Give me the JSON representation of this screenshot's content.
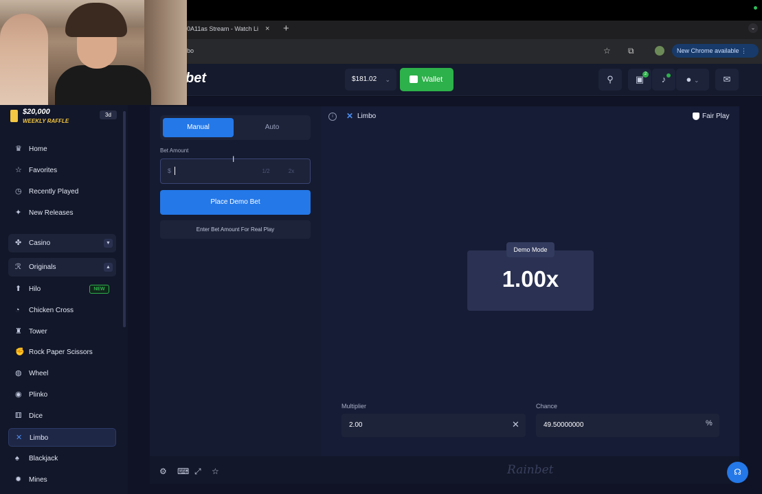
{
  "browser": {
    "tab_title": "0A11as Stream - Watch Li",
    "tab_close": "×",
    "new_tab": "+",
    "tab_menu": "⌄",
    "address_fragment": "bo",
    "new_chrome_label": "New Chrome available ⋮"
  },
  "header": {
    "logo_fragment": "bet",
    "balance": "$181.02",
    "wallet_label": "Wallet",
    "notification_count": "2"
  },
  "sidebar": {
    "raffle_amount": "$20,000",
    "raffle_label": "WEEKLY RAFFLE",
    "raffle_days": "3d",
    "items": [
      {
        "label": "Home",
        "icon": "crown-icon"
      },
      {
        "label": "Favorites",
        "icon": "star-icon"
      },
      {
        "label": "Recently Played",
        "icon": "clock-icon"
      },
      {
        "label": "New Releases",
        "icon": "sparkle-icon"
      }
    ],
    "casino_label": "Casino",
    "originals_label": "Originals",
    "games": [
      {
        "label": "Hilo",
        "badge": "NEW"
      },
      {
        "label": "Chicken Cross"
      },
      {
        "label": "Tower"
      },
      {
        "label": "Rock Paper Scissors"
      },
      {
        "label": "Wheel"
      },
      {
        "label": "Plinko"
      },
      {
        "label": "Dice"
      },
      {
        "label": "Limbo",
        "active": true
      },
      {
        "label": "Blackjack"
      },
      {
        "label": "Mines"
      }
    ]
  },
  "controls": {
    "tab_manual": "Manual",
    "tab_auto": "Auto",
    "bet_amount_label": "Bet Amount",
    "bet_currency": "$",
    "half_label": "1/2",
    "double_label": "2x",
    "place_bet_label": "Place Demo Bet",
    "real_play_label": "Enter Bet Amount For Real Play"
  },
  "game": {
    "title": "Limbo",
    "fair_play_label": "Fair Play",
    "demo_badge": "Demo Mode",
    "multiplier_display": "1.00x",
    "multiplier_label": "Multiplier",
    "multiplier_value": "2.00",
    "chance_label": "Chance",
    "chance_value": "49.50000000",
    "chance_unit": "%",
    "watermark": "Rainbet"
  },
  "colors": {
    "accent_blue": "#2478e8",
    "wallet_green": "#2db14a",
    "raffle_gold": "#f3c643"
  }
}
